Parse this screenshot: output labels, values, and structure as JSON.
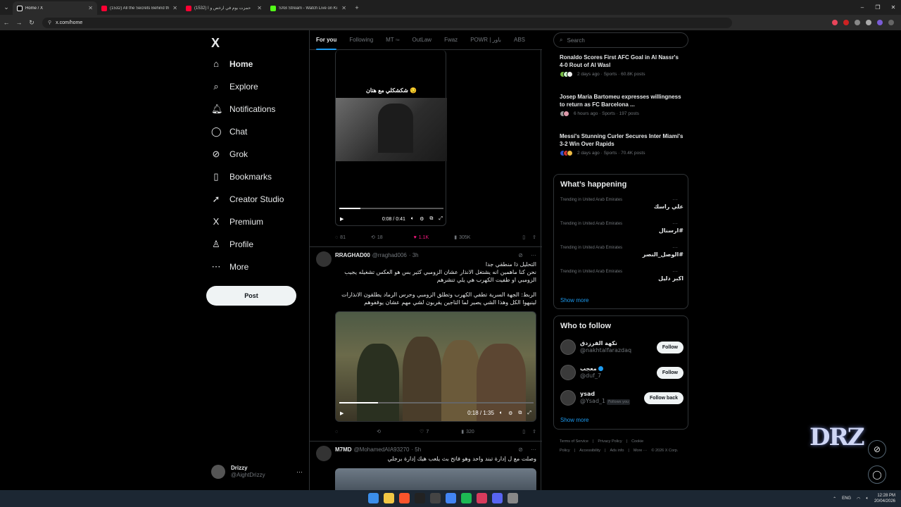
{
  "browser": {
    "tabs": [
      {
        "title": "Home / X",
        "fav": "#000000",
        "active": true
      },
      {
        "title": "(1532) All the Secrets Behind th",
        "fav": "#ff0033",
        "active": false
      },
      {
        "title": "(1532) حمزت يوم في ارخص و ا",
        "fav": "#ff0033",
        "active": false
      },
      {
        "title": "SXB Stream - Watch Live on Ki",
        "fav": "#53fc18",
        "active": false
      }
    ],
    "url": "x.com/home",
    "new_tab": "+",
    "window_controls": [
      "–",
      "❐",
      "✕"
    ]
  },
  "nav": {
    "logo": "X",
    "items": [
      {
        "label": "Home",
        "icon": "⌂"
      },
      {
        "label": "Explore",
        "icon": "⌕"
      },
      {
        "label": "Notifications",
        "icon": "🔔︎"
      },
      {
        "label": "Chat",
        "icon": "◯"
      },
      {
        "label": "Grok",
        "icon": "⊘"
      },
      {
        "label": "Bookmarks",
        "icon": "▯"
      },
      {
        "label": "Creator Studio",
        "icon": "➚"
      },
      {
        "label": "Premium",
        "icon": "X"
      },
      {
        "label": "Profile",
        "icon": "♙"
      },
      {
        "label": "More",
        "icon": "⋯"
      }
    ],
    "post_button": "Post",
    "account": {
      "name": "Drizzy",
      "handle": "@AightDrizzy",
      "menu": "···"
    }
  },
  "timeline": {
    "tabs": [
      "For you",
      "Following",
      "MT",
      "OutLaw",
      "Fwaz",
      "POWR | باور",
      "ABS"
    ],
    "tab_badge": "TM",
    "video1": {
      "caption": "شكشكلي مع هتان 😏",
      "time": "0:08 / 0:41",
      "progress": 0.2,
      "actions": {
        "replies": "81",
        "reposts": "18",
        "likes": "1.1K",
        "views": "305K"
      }
    },
    "tweet2": {
      "name": "RRAGHAD00",
      "handle": "@rraghad006",
      "time": "· 3h",
      "text1": "التحليل ذا منطقي جدا",
      "text2": "نحن كنا ماهمين انه يشتغل الانذار عشان الزومبي كثير بس هو العكس تشغيله يجيب الزومبي او طفيت الكهرب هي يلي تنشرهم",
      "text3": "الربط: الجهة السرية تطفي الكهرب وتطلق الزومبي وحرس الرماد يطلقون الانذارات لينبهوا الكل وهذا الشي يصير لما التاجين يقربون لشي مهم عشان يوقفوهم",
      "video_time": "0:18 / 1:35",
      "progress": 0.2,
      "actions": {
        "replies": "",
        "reposts": "",
        "likes": "7",
        "views": "320"
      }
    },
    "tweet3": {
      "name": "M7MD",
      "handle": "@MohamedAIA93270",
      "time": "· 5h",
      "text": "وصلت مع ل إدارة تبند واحد وهو فاتح بث يلعب هيك إدارة برجلي"
    }
  },
  "right": {
    "search_placeholder": "Search",
    "news": [
      {
        "title": "Ronaldo Scores First AFC Goal in Al Nassr's 4-0 Rout of Al Wasl",
        "meta": "2 days ago · Sports · 60.8K posts"
      },
      {
        "title": "Josep Maria Bartomeu expresses willingness to return as FC Barcelona ...",
        "meta": "6 hours ago · Sports · 197 posts"
      },
      {
        "title": "Messi's Stunning Curler Secures Inter Miami's 3-2 Win Over Rapids",
        "meta": "2 days ago · Sports · 70.4K posts"
      }
    ],
    "happening": {
      "title": "What’s happening",
      "trends": [
        {
          "context": "Trending in United Arab Emirates",
          "name": "علي راسك"
        },
        {
          "context": "Trending in United Arab Emirates",
          "name": "#ارسنال"
        },
        {
          "context": "Trending in United Arab Emirates",
          "name": "#الوصل_النصر"
        },
        {
          "context": "Trending in United Arab Emirates",
          "name": "اكبر دليل"
        }
      ],
      "show_more": "Show more"
    },
    "who_to_follow": {
      "title": "Who to follow",
      "users": [
        {
          "name": "نكهة الفرزدق",
          "handle": "@nakhtalfarazdaq",
          "button": "Follow",
          "follows_you": ""
        },
        {
          "name": "معجب",
          "handle": "@duf_7",
          "button": "Follow",
          "follows_you": ""
        },
        {
          "name": "ysad",
          "handle": "@Ysad_1",
          "button": "Follow back",
          "follows_you": "Follows you"
        }
      ],
      "show_more": "Show more"
    },
    "footer": [
      "Terms of Service",
      "|",
      "Privacy Policy",
      "|",
      "Cookie Policy",
      "|",
      "Accessibility",
      "|",
      "Ads info",
      "|",
      "More ···",
      "© 2026 X Corp."
    ]
  },
  "overlay": {
    "logo_text": "DRZ"
  },
  "taskbar": {
    "lang": "ENG",
    "time": "12:28 PM",
    "date": "20/04/2026"
  }
}
